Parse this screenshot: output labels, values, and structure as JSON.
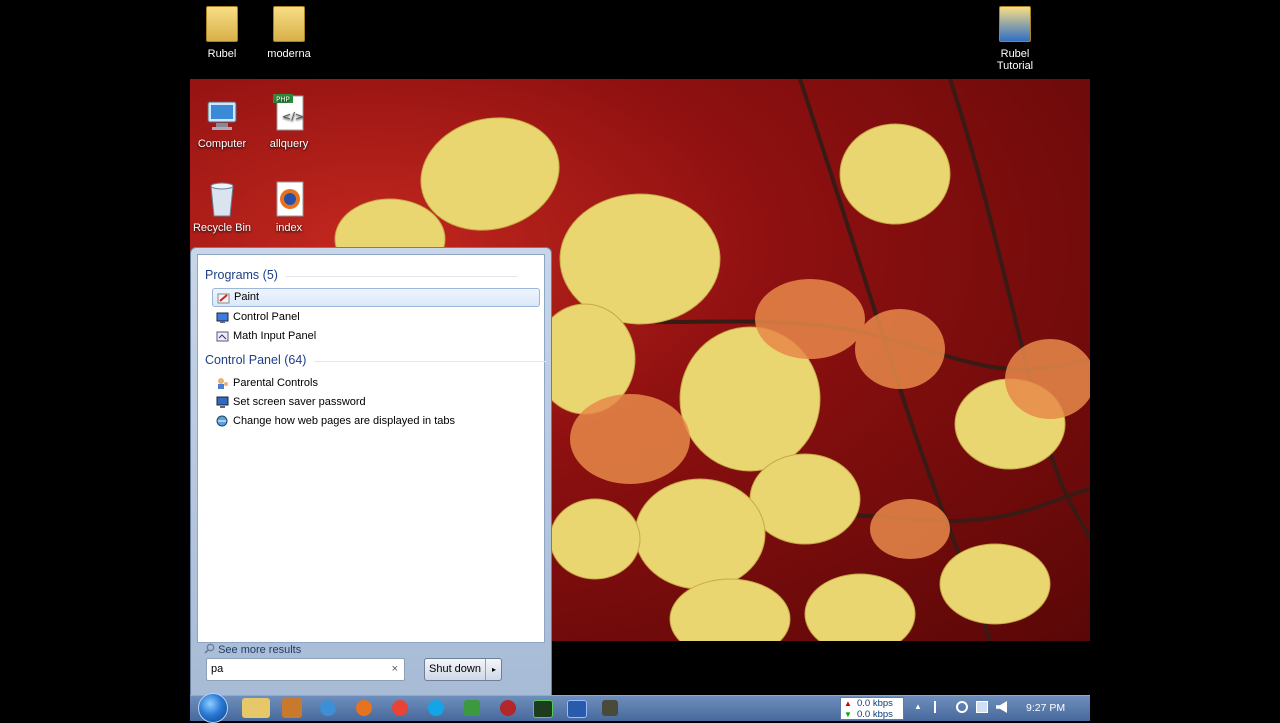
{
  "desktop": {
    "icons": [
      {
        "label": "Rubel"
      },
      {
        "label": "moderna"
      },
      {
        "label": "Rubel Tutorial"
      },
      {
        "label": "Computer"
      },
      {
        "label": "allquery"
      },
      {
        "label": "Recycle Bin"
      },
      {
        "label": "index"
      }
    ]
  },
  "start_menu": {
    "programs_header": "Programs (5)",
    "programs": [
      {
        "label": "Paint",
        "icon": "paint-icon",
        "selected": true
      },
      {
        "label": "Control Panel",
        "icon": "control-panel-icon"
      },
      {
        "label": "Math Input Panel",
        "icon": "math-input-panel-icon"
      }
    ],
    "control_panel_header": "Control Panel (64)",
    "control_panel_items": [
      {
        "label": "Parental Controls",
        "icon": "parental-controls-icon"
      },
      {
        "label": "Set screen saver password",
        "icon": "screen-saver-icon"
      },
      {
        "label": "Change how web pages are displayed in tabs",
        "icon": "internet-options-icon"
      }
    ],
    "see_more": "See more results",
    "search": {
      "value": "pa",
      "clear_glyph": "×"
    },
    "shutdown_label": "Shut down",
    "shutdown_arrow": "▸"
  },
  "taskbar": {
    "net_up": "0.0 kbps",
    "net_down": "0.0 kbps",
    "tray_arrow": "▲",
    "clock": "9:27 PM"
  },
  "colors": {
    "accent": "#1e3f87",
    "taskbar": "#47689b",
    "wallpaper_red": "#8e1010",
    "leaf_yellow": "#e9d36a"
  }
}
